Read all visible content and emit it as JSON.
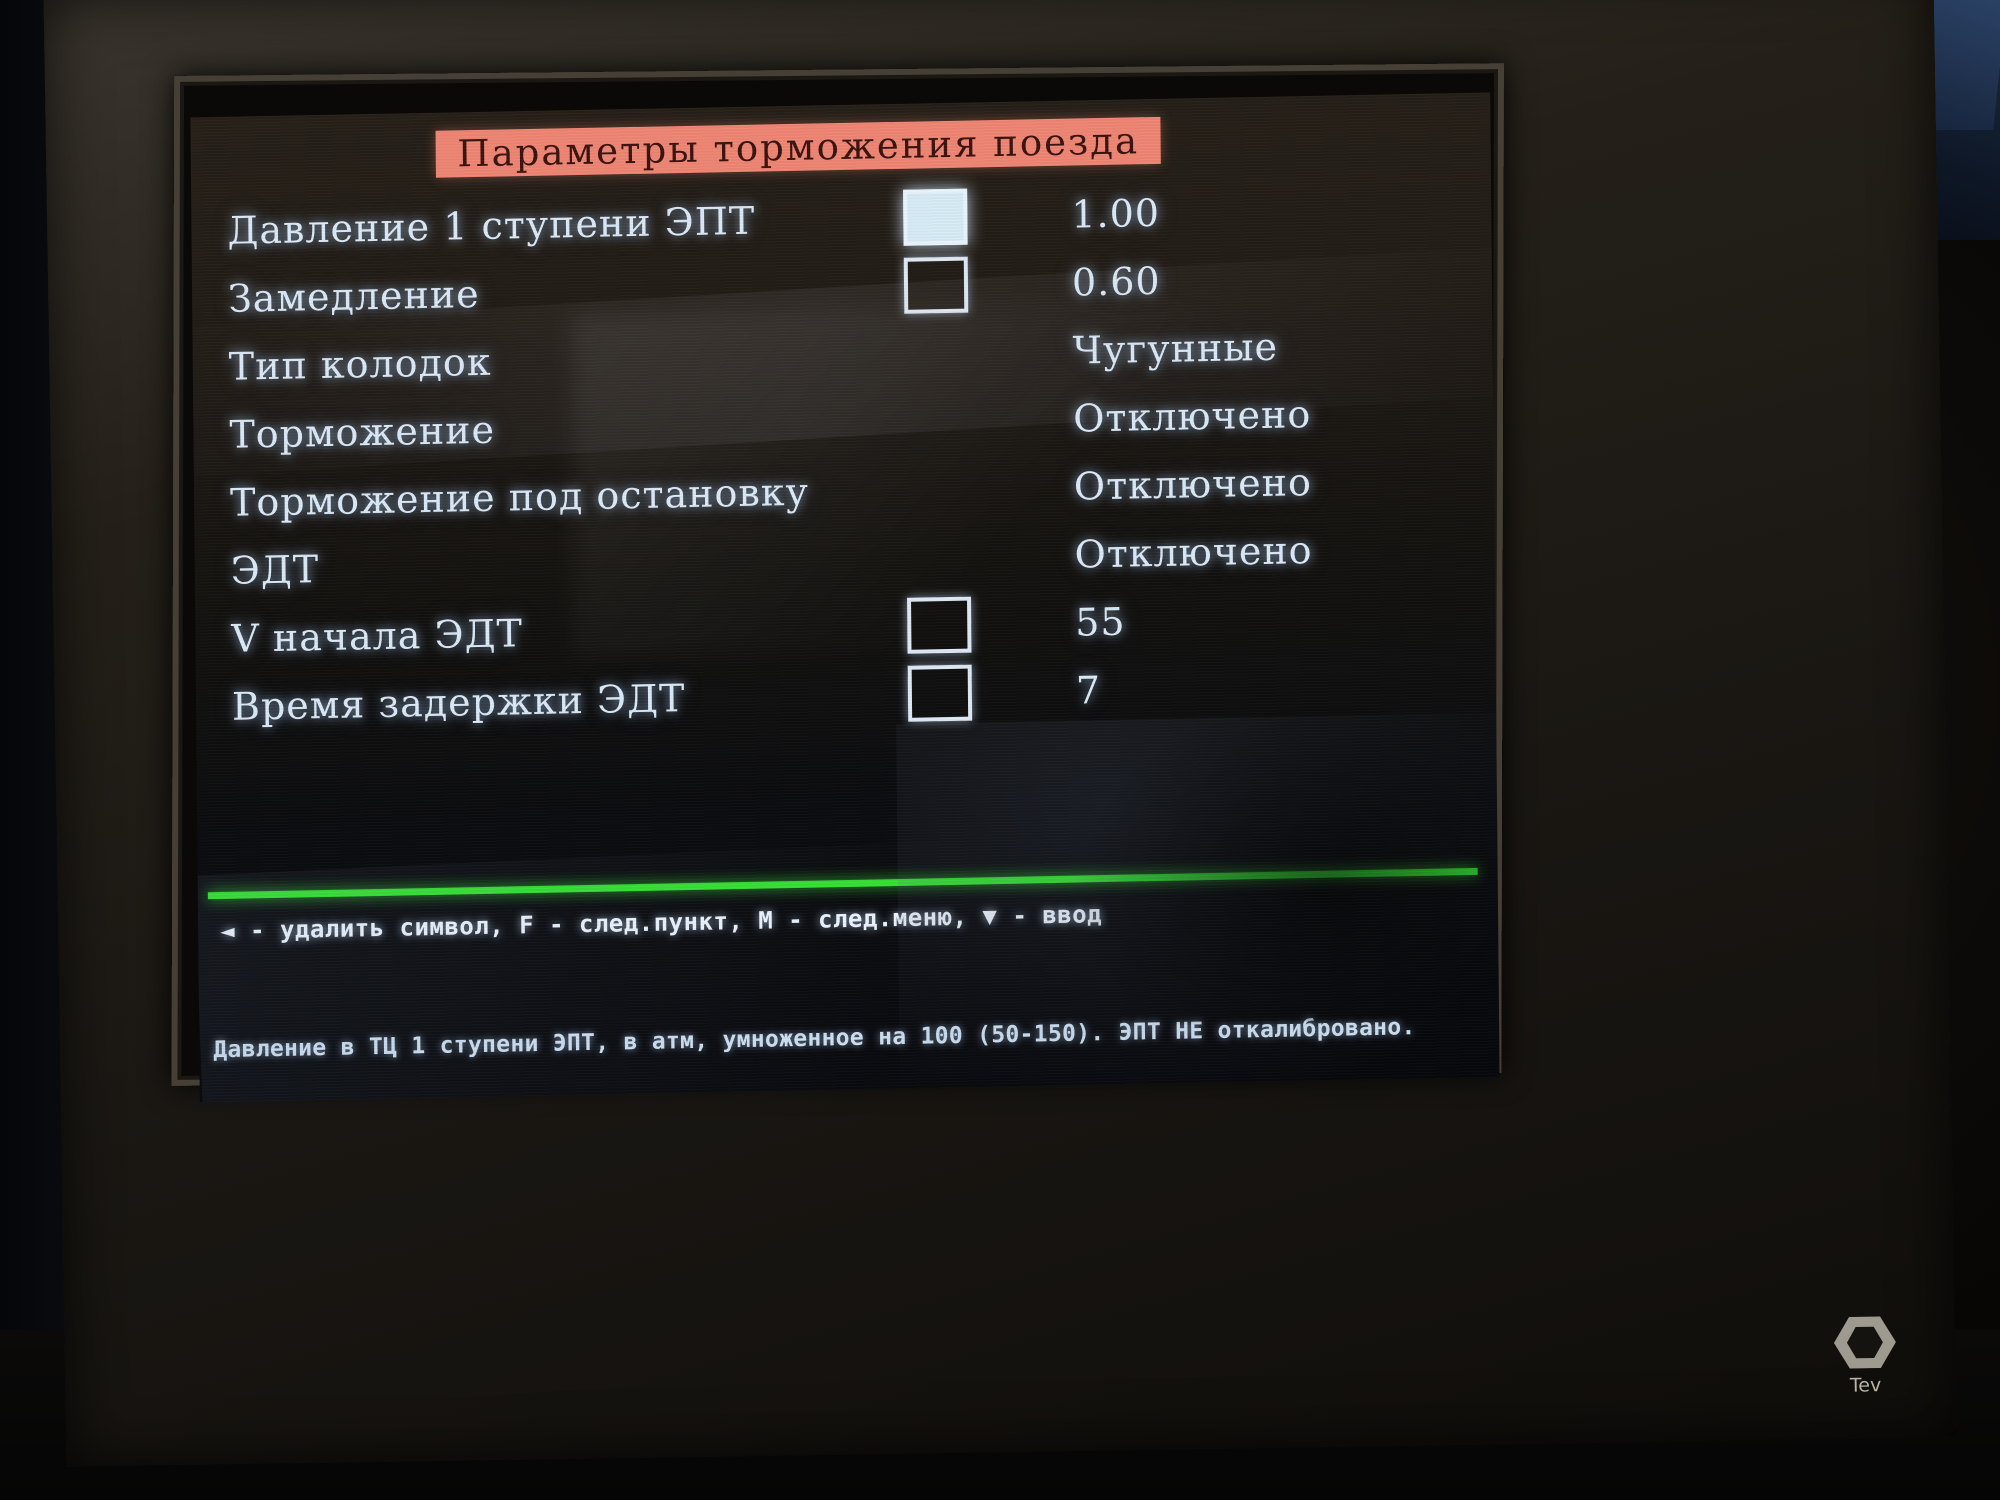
{
  "device": {
    "brand_label": "Tev",
    "brand_url": "www."
  },
  "screen": {
    "title": "Параметры торможения поезда",
    "accent_title_bg": "#f08674",
    "accent_divider": "#35e233",
    "text_color": "#dceaf8",
    "rows": [
      {
        "label": "Давление 1 ступени ЭПТ",
        "box": "filled",
        "value": "1.00"
      },
      {
        "label": "Замедление",
        "box": "empty",
        "value": "0.60"
      },
      {
        "label": "Тип колодок",
        "box": "none",
        "value": "Чугунные"
      },
      {
        "label": "Торможение",
        "box": "none",
        "value": "Отключено"
      },
      {
        "label": "Торможение под остановку",
        "box": "none",
        "value": "Отключено"
      },
      {
        "label": "ЭДТ",
        "box": "none",
        "value": "Отключено"
      },
      {
        "label": "V начала ЭДТ",
        "box": "empty",
        "value": "55"
      },
      {
        "label": "Время задержки ЭДТ",
        "box": "empty",
        "value": "7"
      }
    ],
    "hint_line": "◄ - удалить символ, F - след.пункт, M - след.меню, ▼ - ввод",
    "status_line": "Давление в ТЦ 1 ступени ЭПТ, в атм, умноженное на 100 (50-150). ЭПТ НЕ откалибровано."
  }
}
